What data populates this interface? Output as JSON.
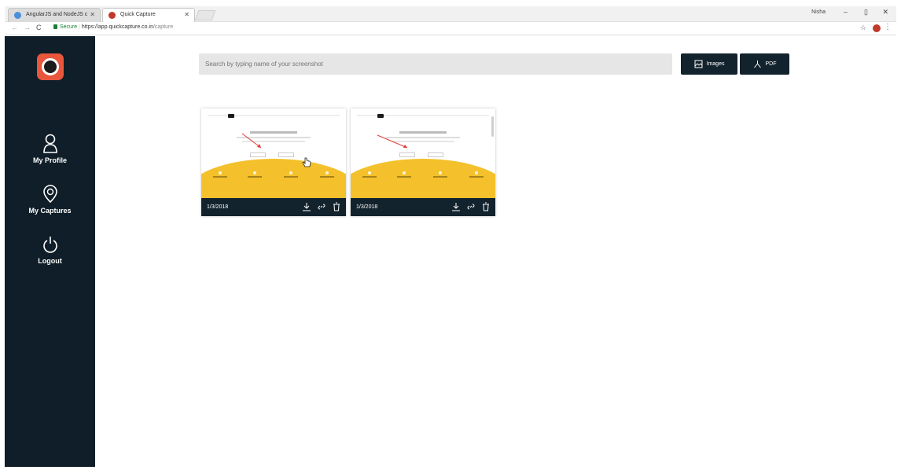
{
  "browser": {
    "tabs": [
      {
        "title": "AngularJS and NodeJS c"
      },
      {
        "title": "Quick Capture"
      }
    ],
    "user": "Nisha",
    "window_controls": {
      "minimize": "–",
      "maximize": "▯",
      "close": "✕"
    },
    "address": {
      "secure_label": "Secure",
      "url_host": "https://app.quickcapture.co.in",
      "url_path": "/capture"
    }
  },
  "sidebar": {
    "items": [
      {
        "label": "My Profile",
        "icon": "user-icon"
      },
      {
        "label": "My Captures",
        "icon": "location-pin-icon"
      },
      {
        "label": "Logout",
        "icon": "power-icon"
      }
    ]
  },
  "search": {
    "placeholder": "Search by typing name of your screenshot"
  },
  "buttons": {
    "images_label": "Images",
    "pdf_label": "PDF"
  },
  "captures": [
    {
      "date": "1/3/2018"
    },
    {
      "date": "1/3/2018"
    }
  ],
  "colors": {
    "sidebar_bg": "#0f1e28",
    "button_bg": "#13232e",
    "accent_yellow": "#f4c12c",
    "logo": "#e8563c"
  }
}
